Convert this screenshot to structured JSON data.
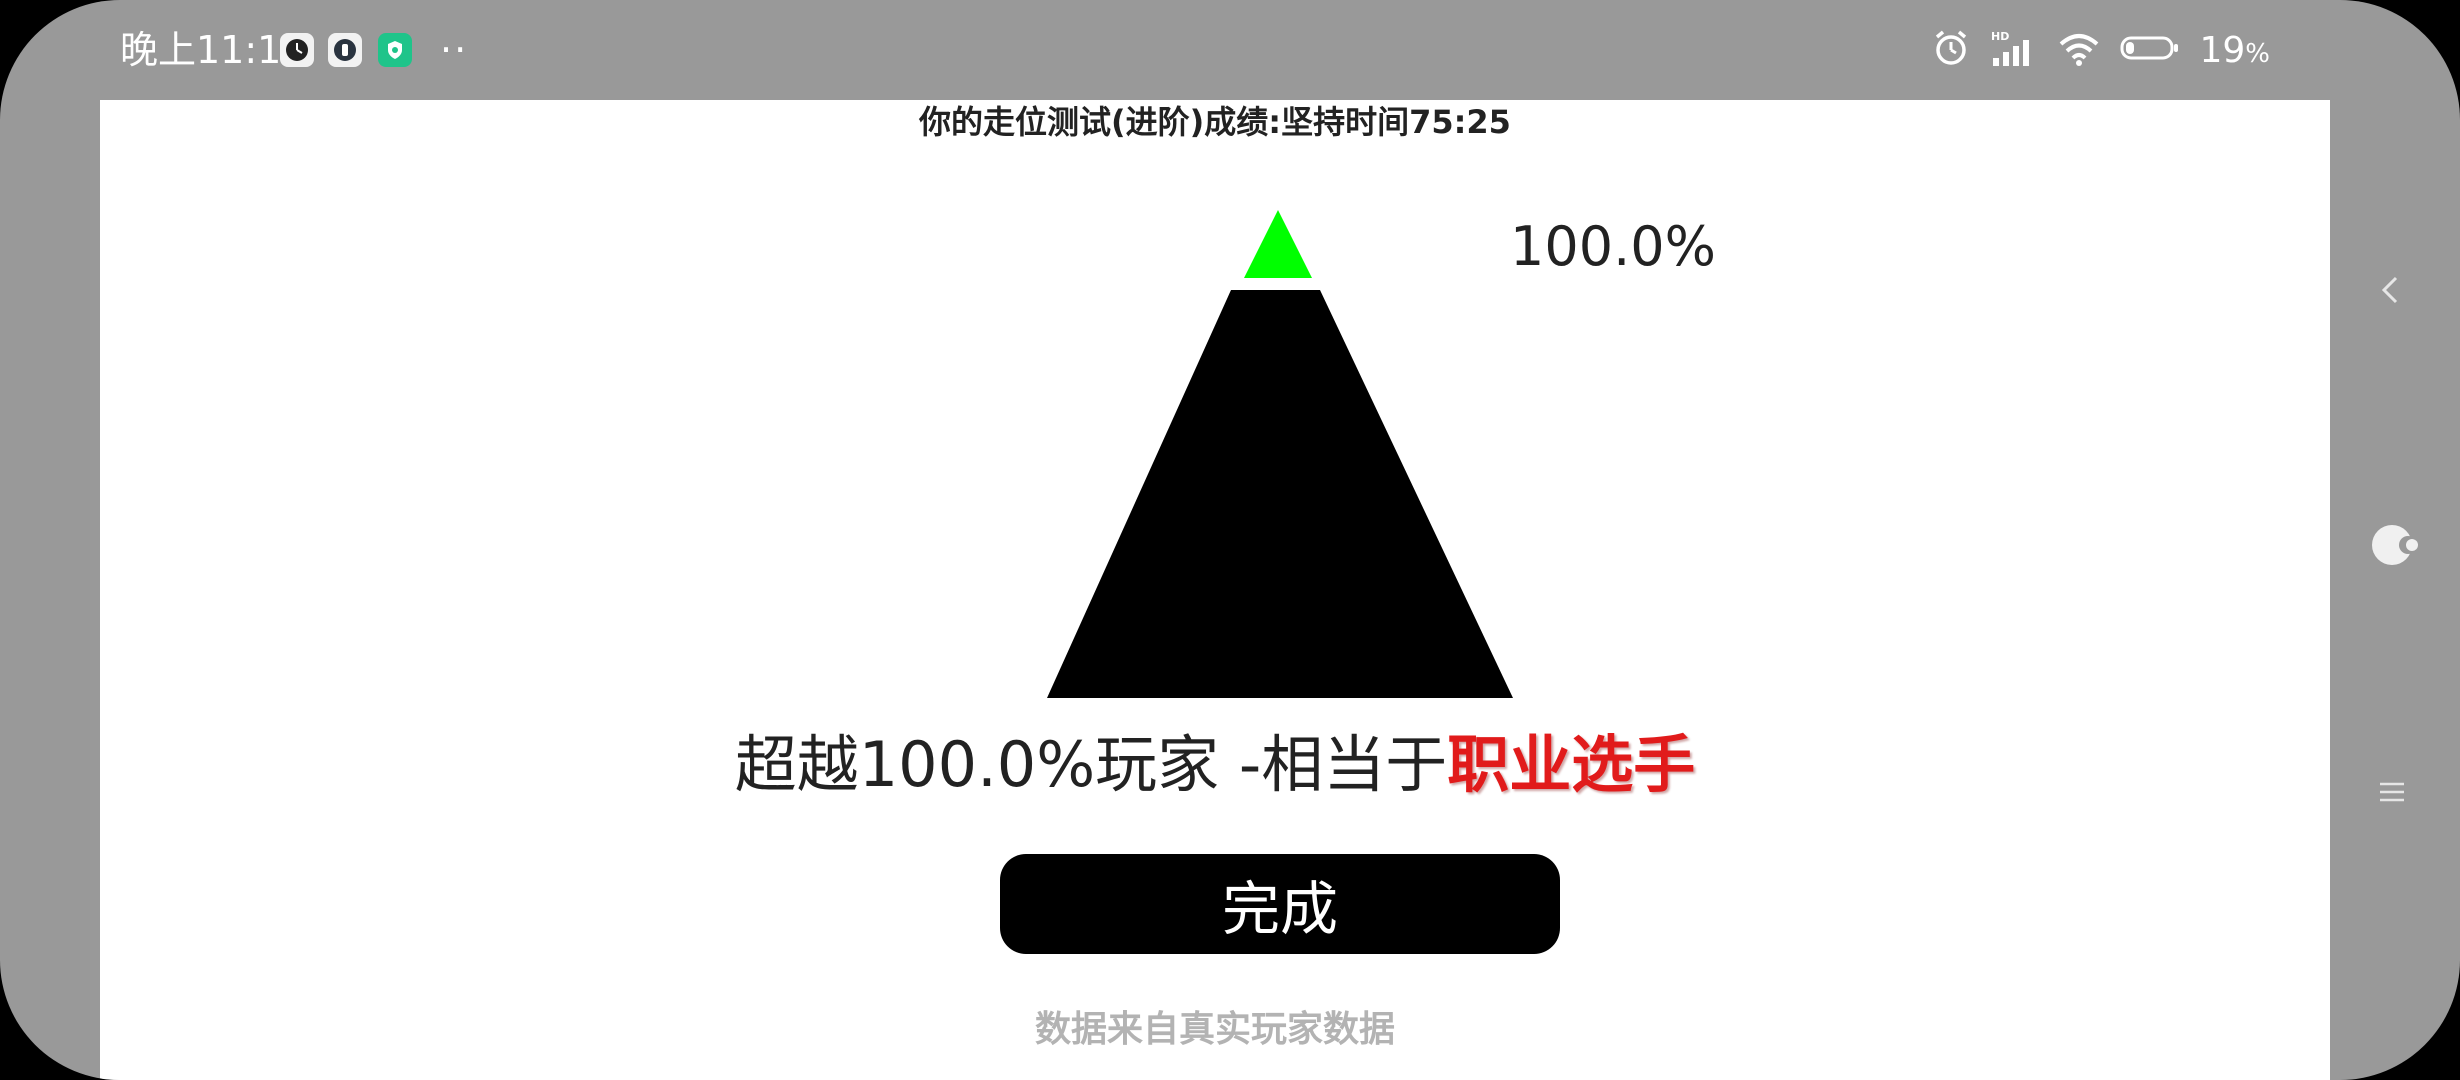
{
  "statusbar": {
    "time": "晚上11:11",
    "more": "··",
    "battery": "19",
    "battery_unit": "%",
    "network": "HD"
  },
  "result": {
    "title": "你的走位测试(进阶)成绩:坚持时间75:25",
    "percent": "100.0%",
    "percent_value": 100.0,
    "summary_prefix": "超越100.0%玩家 -相当于",
    "rank": "职业选手",
    "done_label": "完成",
    "footnote": "数据来自真实玩家数据"
  },
  "colors": {
    "pyramid_top": "#00ff00",
    "pyramid_base": "#000000",
    "rank_text": "#e11b1b",
    "footnote": "#b3b3b3",
    "frame": "#999999"
  }
}
